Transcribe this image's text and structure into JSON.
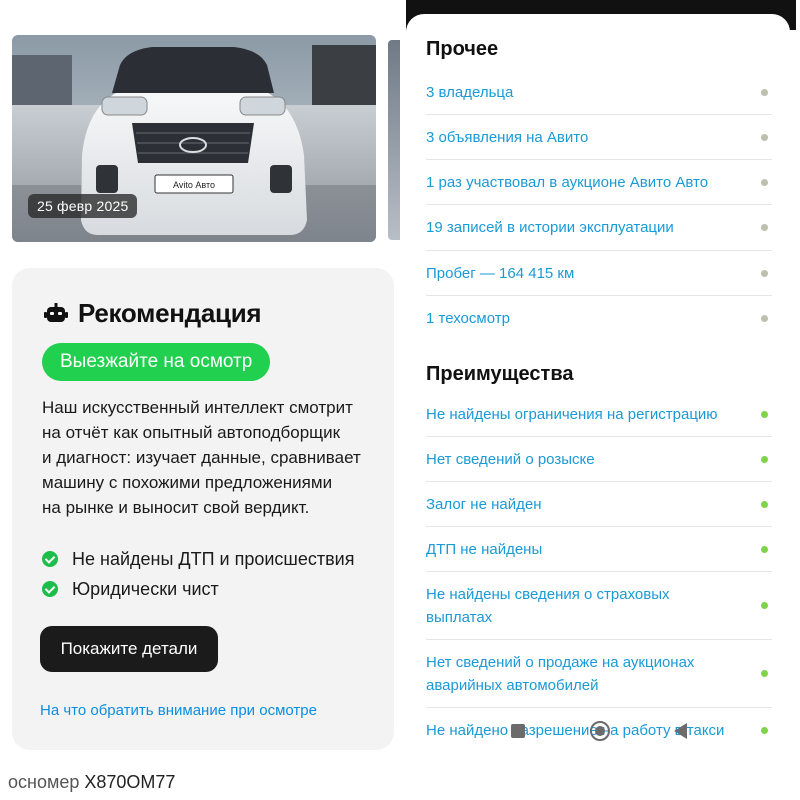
{
  "left": {
    "photo": {
      "date": "25 февр 2025",
      "plate_text": "Avito Авто"
    },
    "recommendation": {
      "title": "Рекомендация",
      "verdict": "Выезжайте на осмотр",
      "description_lines": [
        "Наш искусственный интеллект смотрит",
        "на отчёт как опытный автоподборщик",
        "и диагност: изучает данные, сравнивает",
        "машину с похожими предложениями",
        "на рынке и выносит свой вердикт."
      ],
      "checks": [
        "Не найдены ДТП и происшествия",
        "Юридически чист"
      ],
      "details_button": "Покажите детали",
      "inspect_link": "На что обратить внимание при осмотре"
    },
    "plate": {
      "prefix": "осномер",
      "value": "X870OM77"
    }
  },
  "right": {
    "other": {
      "title": "Прочее",
      "items": [
        "3 владельца",
        "3 объявления на Авито",
        "1 раз участвовал в аукционе Авито Авто",
        "19 записей в истории эксплуатации",
        "Пробег — 164 415 км",
        "1 техосмотр"
      ]
    },
    "advantages": {
      "title": "Преимущества",
      "items": [
        "Не найдены ограничения на регистрацию",
        "Нет сведений о розыске",
        "Залог не найден",
        "ДТП не найдены",
        "Не найдены сведения о страховых выплатах",
        "Нет сведений о продаже на аукционах аварийных автомобилей",
        "Не найдено разрешение на работу в такси"
      ]
    }
  },
  "colors": {
    "accent_green": "#22d04f",
    "link_blue": "#1a9ad6",
    "dot_grey": "#bfbfaf",
    "dot_green": "#7fd34a"
  }
}
